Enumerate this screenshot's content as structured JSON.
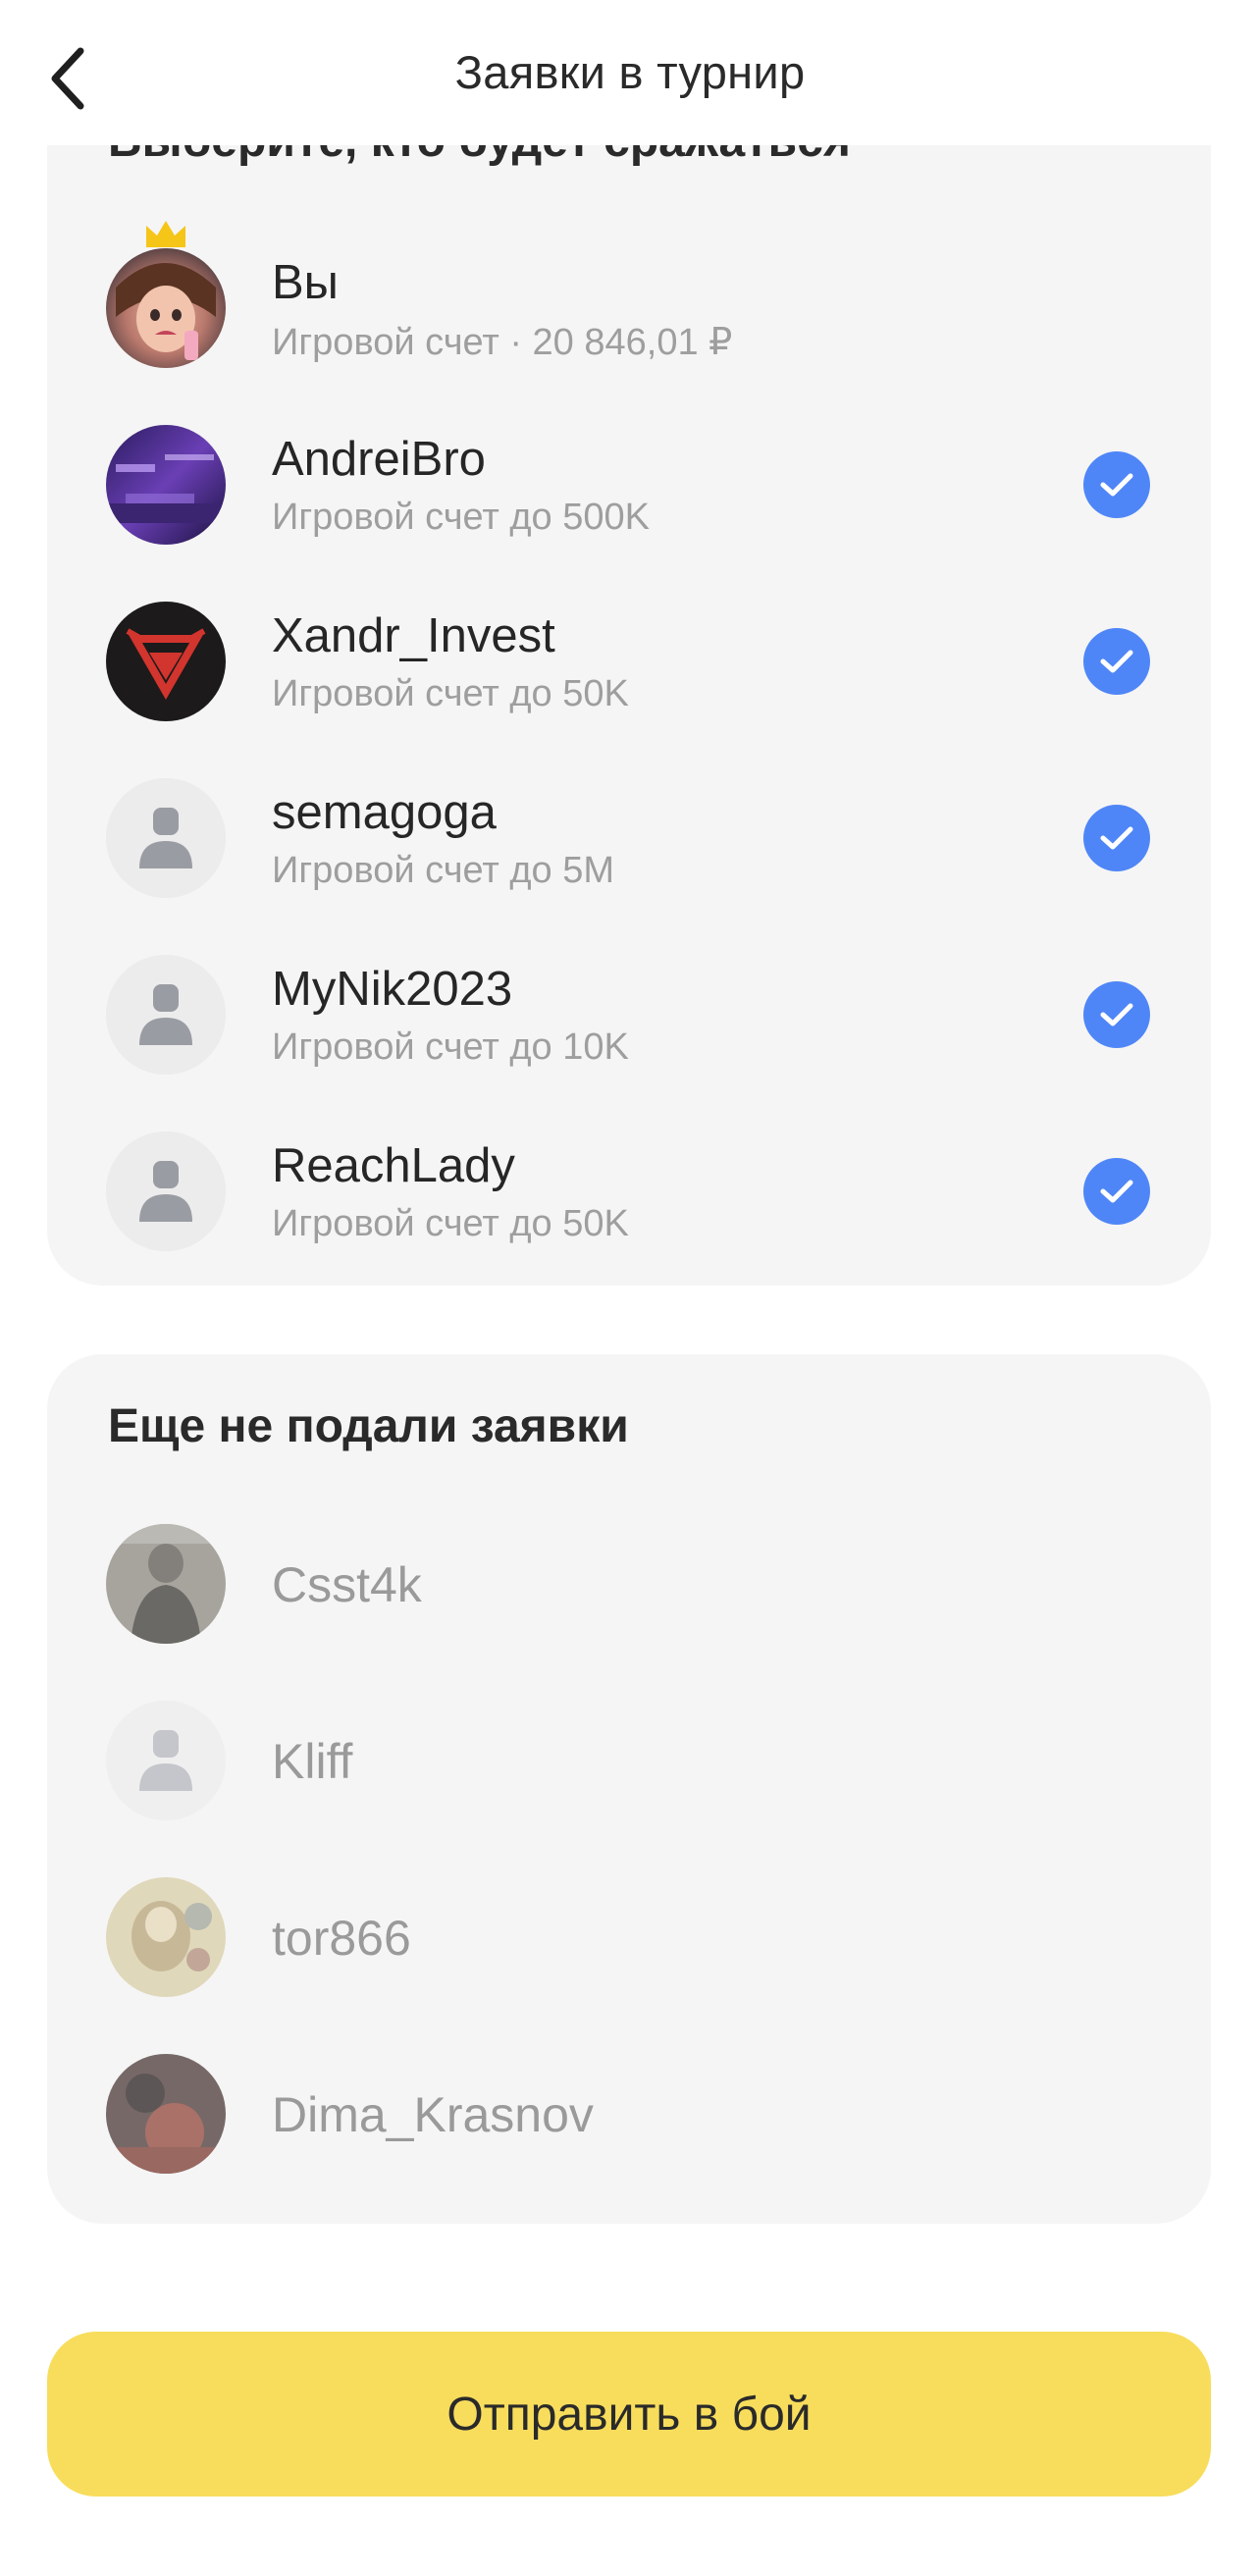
{
  "header": {
    "title": "Заявки в турнир"
  },
  "applied": {
    "heading": "Выберите, кто будет сражаться",
    "members": [
      {
        "name": "Вы",
        "subtitle": "Игровой счет · 20 846,01 ₽",
        "checked": false,
        "avatar": "user-photo",
        "crown": true
      },
      {
        "name": "AndreiBro",
        "subtitle": "Игровой счет до 500K",
        "checked": true,
        "avatar": "user-photo"
      },
      {
        "name": "Xandr_Invest",
        "subtitle": "Игровой счет до 50K",
        "checked": true,
        "avatar": "user-photo"
      },
      {
        "name": "semagoga",
        "subtitle": "Игровой счет до 5M",
        "checked": true,
        "avatar": "placeholder"
      },
      {
        "name": "MyNik2023",
        "subtitle": "Игровой счет до 10K",
        "checked": true,
        "avatar": "placeholder"
      },
      {
        "name": "ReachLady",
        "subtitle": "Игровой счет до 50K",
        "checked": true,
        "avatar": "placeholder"
      }
    ]
  },
  "not_applied": {
    "heading": "Еще не подали заявки",
    "members": [
      {
        "name": "Csst4k",
        "avatar": "user-photo"
      },
      {
        "name": "Kliff",
        "avatar": "placeholder"
      },
      {
        "name": "tor866",
        "avatar": "user-photo"
      },
      {
        "name": "Dima_Krasnov",
        "avatar": "user-photo"
      }
    ]
  },
  "actions": {
    "send_label": "Отправить в бой"
  },
  "colors": {
    "accent_yellow": "#f8dd5c",
    "check_blue": "#4f86f7",
    "card_bg": "#f5f5f5",
    "crown": "#f5c518"
  },
  "icons": {
    "back": "chevron-left-icon",
    "check": "checkmark-circle-icon",
    "crown": "crown-icon",
    "placeholder": "user-placeholder-icon"
  }
}
